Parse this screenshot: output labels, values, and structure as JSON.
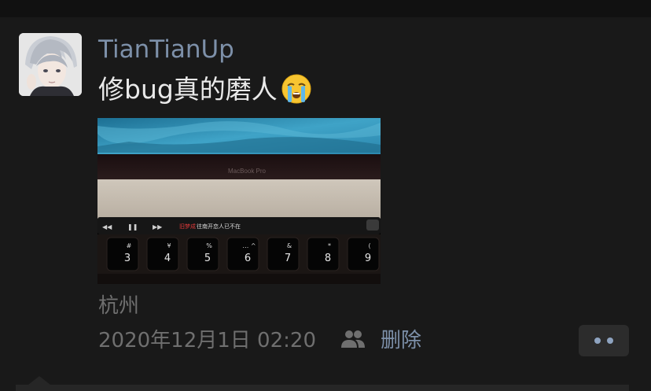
{
  "post": {
    "username": "TianTianUp",
    "text": "修bug真的磨人",
    "emoji": "crying-face-emoji",
    "location": "杭州",
    "timestamp": "2020年12月1日 02:20",
    "delete_label": "删除"
  },
  "photo": {
    "laptop_label": "MacBook Pro",
    "touchbar_song": "旧梦成",
    "touchbar_lyric": "往南开恋人已不在",
    "keys": [
      {
        "symbol": "#",
        "digit": "3"
      },
      {
        "symbol": "¥",
        "digit": "4"
      },
      {
        "symbol": "%",
        "digit": "5"
      },
      {
        "symbol": "… ^",
        "digit": "6"
      },
      {
        "symbol": "&",
        "digit": "7"
      },
      {
        "symbol": "*",
        "digit": "8"
      },
      {
        "symbol": "(",
        "digit": "9"
      }
    ]
  },
  "icons": {
    "friends": "friends-icon",
    "more": "more-dots-icon"
  },
  "colors": {
    "background": "#191919",
    "link": "#7d90a9",
    "text": "#e9e9e9",
    "muted": "#6f6f6f"
  }
}
